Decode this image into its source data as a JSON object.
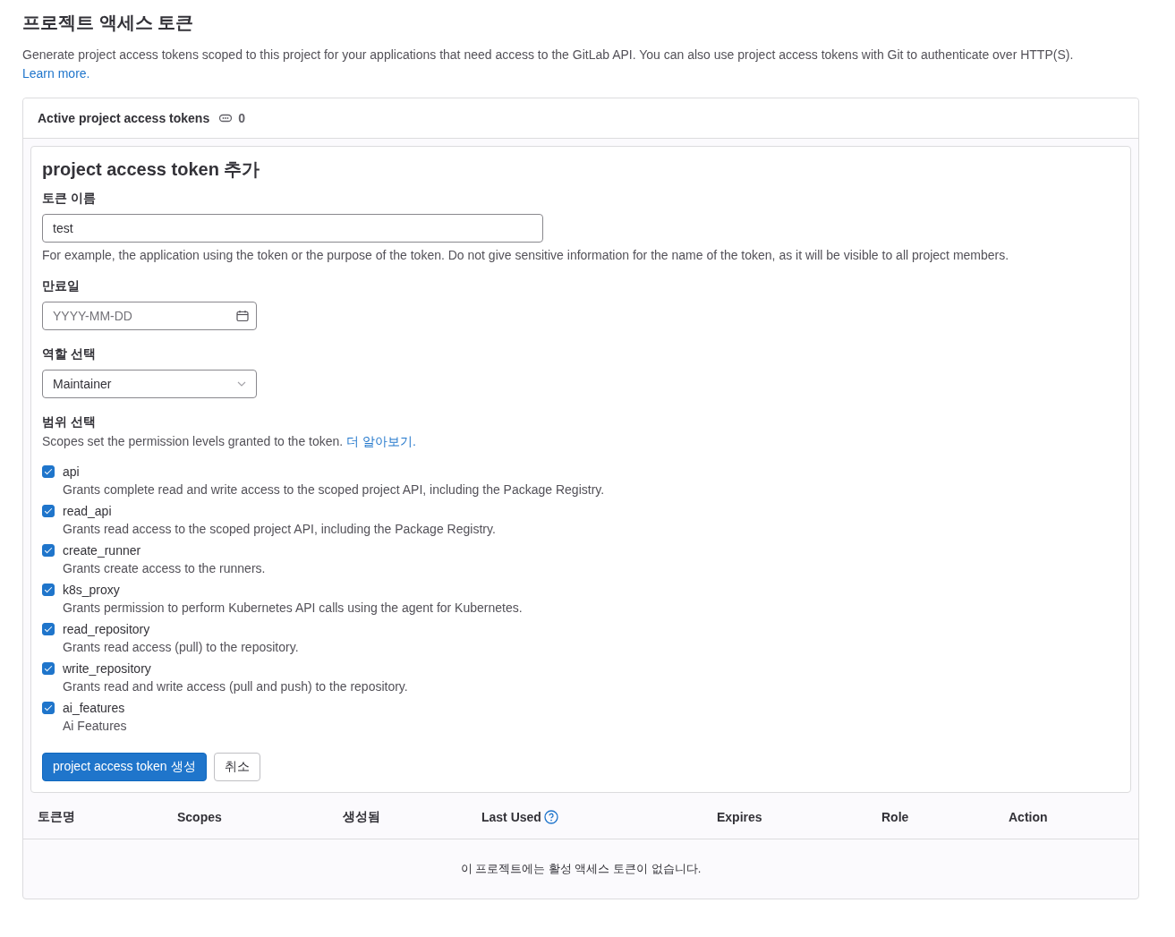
{
  "page": {
    "title": "프로젝트 액세스 토큰",
    "description": "Generate project access tokens scoped to this project for your applications that need access to the GitLab API. You can also use project access tokens with Git to authenticate over HTTP(S).",
    "learn_more": "Learn more."
  },
  "card_header": {
    "title": "Active project access tokens",
    "count": "0"
  },
  "token_form": {
    "title": "project access token 추가",
    "name_field": {
      "label": "토큰 이름",
      "value": "test",
      "help": "For example, the application using the token or the purpose of the token. Do not give sensitive information for the name of the token, as it will be visible to all project members."
    },
    "expiry_field": {
      "label": "만료일",
      "placeholder": "YYYY-MM-DD"
    },
    "role_field": {
      "label": "역할 선택",
      "value": "Maintainer"
    },
    "scopes": {
      "label": "범위 선택",
      "help": "Scopes set the permission levels granted to the token.",
      "help_link": "더 알아보기.",
      "items": [
        {
          "name": "api",
          "description": "Grants complete read and write access to the scoped project API, including the Package Registry.",
          "checked": true
        },
        {
          "name": "read_api",
          "description": "Grants read access to the scoped project API, including the Package Registry.",
          "checked": true
        },
        {
          "name": "create_runner",
          "description": "Grants create access to the runners.",
          "checked": true
        },
        {
          "name": "k8s_proxy",
          "description": "Grants permission to perform Kubernetes API calls using the agent for Kubernetes.",
          "checked": true
        },
        {
          "name": "read_repository",
          "description": "Grants read access (pull) to the repository.",
          "checked": true
        },
        {
          "name": "write_repository",
          "description": "Grants read and write access (pull and push) to the repository.",
          "checked": true
        },
        {
          "name": "ai_features",
          "description": "Ai Features",
          "checked": true
        }
      ]
    },
    "buttons": [
      {
        "label": "project access token 생성",
        "kind": "primary"
      },
      {
        "label": "취소",
        "kind": "default"
      }
    ]
  },
  "table": {
    "columns": [
      {
        "label": "토큰명",
        "help": false
      },
      {
        "label": "Scopes",
        "help": false
      },
      {
        "label": "생성됨",
        "help": false
      },
      {
        "label": "Last Used",
        "help": true
      },
      {
        "label": "Expires",
        "help": false
      },
      {
        "label": "Role",
        "help": false
      },
      {
        "label": "Action",
        "help": false
      }
    ],
    "empty_message": "이 프로젝트에는 활성 액세스 토큰이 없습니다."
  }
}
